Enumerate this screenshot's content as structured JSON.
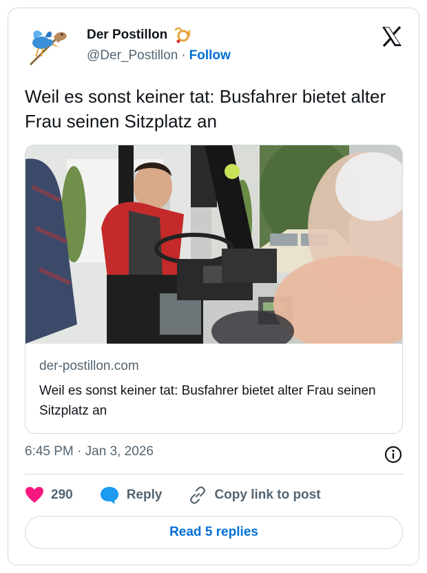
{
  "author": {
    "name": "Der Postillon",
    "handle": "@Der_Postillon",
    "separator": "·",
    "follow_label": "Follow"
  },
  "tweet": {
    "text": "Weil es sonst keiner tat: Busfahrer bietet alter Frau seinen Sitzplatz an"
  },
  "link_card": {
    "domain": "der-postillon.com",
    "title": "Weil es sonst keiner tat: Busfahrer bietet alter Frau seinen Sitzplatz an"
  },
  "meta": {
    "timestamp": "6:45 PM · Jan 3, 2026"
  },
  "actions": {
    "like_count": "290",
    "reply_label": "Reply",
    "copy_label": "Copy link to post"
  },
  "read_replies_label": "Read 5 replies",
  "colors": {
    "accent": "#006fd6",
    "like": "#f91880",
    "reply_bubble": "#1d9bf0",
    "text": "#0f1419",
    "muted": "#536471",
    "border": "#cfd9de"
  },
  "icons": [
    "stork-hobbyhorse-avatar",
    "post-horn-icon",
    "x-logo-icon",
    "info-icon",
    "heart-icon",
    "reply-bubble-icon",
    "link-icon"
  ]
}
